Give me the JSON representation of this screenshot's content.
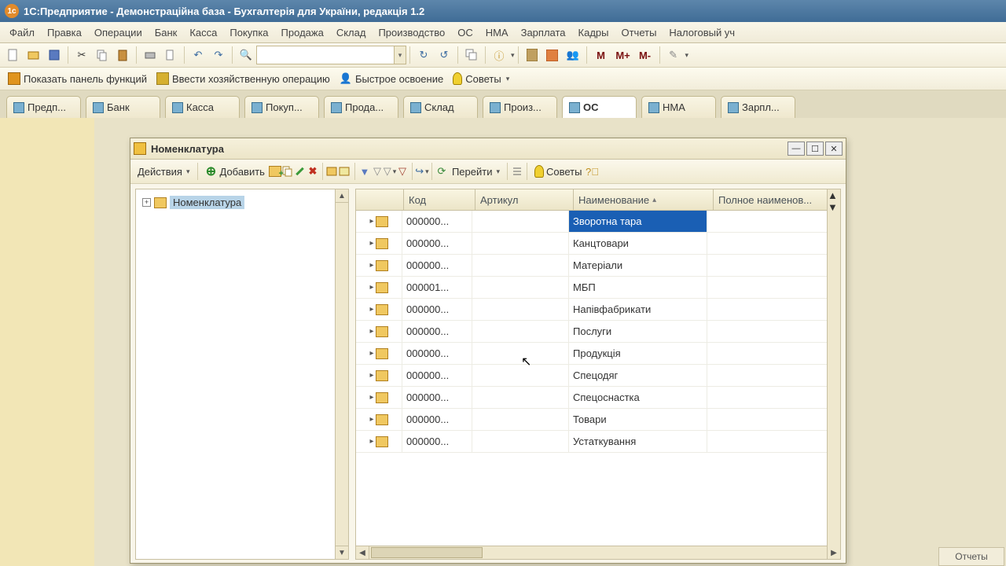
{
  "titlebar": {
    "text": "1С:Предприятие - Демонстраційна база - Бухгалтерія для України, редакція 1.2"
  },
  "menu": [
    "Файл",
    "Правка",
    "Операции",
    "Банк",
    "Касса",
    "Покупка",
    "Продажа",
    "Склад",
    "Производство",
    "ОС",
    "НМА",
    "Зарплата",
    "Кадры",
    "Отчеты",
    "Налоговый уч"
  ],
  "toolbar2": {
    "panel": "Показать панель функций",
    "oper": "Ввести хозяйственную операцию",
    "fast": "Быстрое освоение",
    "tips": "Советы"
  },
  "tabs": [
    "Предп...",
    "Банк",
    "Касса",
    "Покуп...",
    "Прода...",
    "Склад",
    "Произ...",
    "ОС",
    "НМА",
    "Зарпл..."
  ],
  "subwin": {
    "title": "Номенклатура",
    "actions": "Действия",
    "add": "Добавить",
    "goto": "Перейти",
    "tips": "Советы",
    "treeRoot": "Номенклатура",
    "head": {
      "code": "Код",
      "art": "Артикул",
      "name": "Наименование",
      "full": "Полное наименов..."
    },
    "rows": [
      {
        "code": "000000...",
        "art": "",
        "name": "Зворотна тара",
        "sel": true
      },
      {
        "code": "000000...",
        "art": "",
        "name": "Канцтовари"
      },
      {
        "code": "000000...",
        "art": "",
        "name": "Матеріали"
      },
      {
        "code": "000001...",
        "art": "",
        "name": "МБП"
      },
      {
        "code": "000000...",
        "art": "",
        "name": "Напівфабрикати"
      },
      {
        "code": "000000...",
        "art": "",
        "name": "Послуги"
      },
      {
        "code": "000000...",
        "art": "",
        "name": "Продукція"
      },
      {
        "code": "000000...",
        "art": "",
        "name": "Спецодяг"
      },
      {
        "code": "000000...",
        "art": "",
        "name": "Спецоснастка"
      },
      {
        "code": "000000...",
        "art": "",
        "name": "Товари"
      },
      {
        "code": "000000...",
        "art": "",
        "name": "Устаткування"
      }
    ]
  },
  "m_buttons": [
    "M",
    "M+",
    "M-"
  ],
  "rb": "Отчеты"
}
